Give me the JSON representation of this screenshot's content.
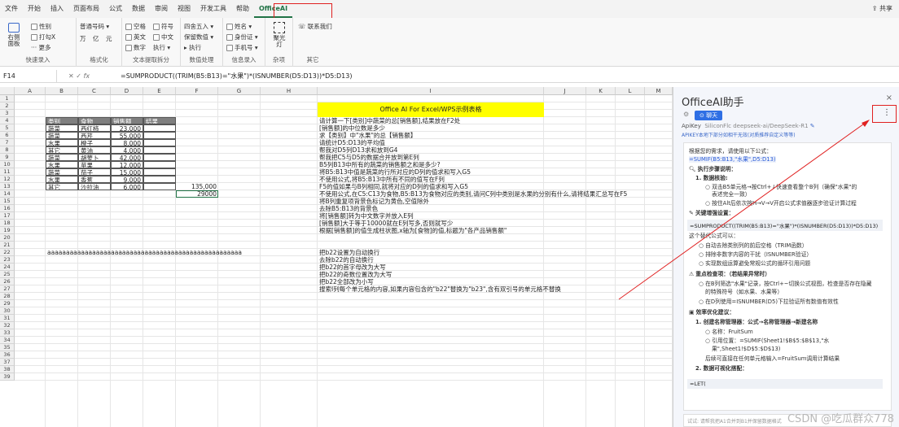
{
  "ribbon": {
    "tabs": [
      "文件",
      "开始",
      "插入",
      "页面布局",
      "公式",
      "数据",
      "审阅",
      "视图",
      "开发工具",
      "帮助",
      "OfficeAI"
    ],
    "active_tab": "OfficeAI",
    "share_label": "共享",
    "groups": [
      {
        "label": "快速录入",
        "items": [
          "右侧面板",
          "性别",
          "打勾X",
          "更多"
        ]
      },
      {
        "label": "格式化",
        "items": [
          "普通号码",
          "万",
          "亿",
          "元"
        ]
      },
      {
        "label": "文本提取拆分",
        "items": [
          "空格",
          "符号",
          "英文",
          "中文",
          "数字",
          "执行"
        ]
      },
      {
        "label": "数值处理",
        "items": [
          "四舍五入",
          "保留数值",
          "执行"
        ]
      },
      {
        "label": "信息录入",
        "items": [
          "姓名",
          "身份证",
          "手机号"
        ]
      },
      {
        "label": "杂项",
        "items": [
          "聚光灯"
        ]
      },
      {
        "label": "其它",
        "items": [
          "联系我们"
        ]
      }
    ]
  },
  "formula_bar": {
    "cell_ref": "F14",
    "fx": "fx",
    "formula": "=SUMPRODUCT((TRIM(B5:B13)=\"水果\")*(ISNUMBER(D5:D13))*D5:D13)"
  },
  "sheet": {
    "columns": [
      "A",
      "B",
      "C",
      "D",
      "E",
      "F",
      "G",
      "H",
      "I",
      "J",
      "K",
      "L",
      "M"
    ],
    "rows": [
      "1",
      "2",
      "3",
      "4",
      "5",
      "6",
      "7",
      "8",
      "9",
      "10",
      "11",
      "12",
      "13",
      "14",
      "15",
      "16",
      "17",
      "18",
      "19",
      "20",
      "21",
      "22",
      "23",
      "24",
      "25",
      "26",
      "27",
      "28",
      "29",
      "30",
      "31",
      "32",
      "33",
      "34",
      "35",
      "36",
      "37",
      "38",
      "39"
    ],
    "banner": "Office AI For Excel/WPS示例表格",
    "table_headers": [
      "类别",
      "食物",
      "销售额",
      "结果"
    ],
    "table_rows": [
      [
        "蔬菜",
        "西红柿",
        "23,000"
      ],
      [
        "蔬菜",
        "西芹",
        "55,000"
      ],
      [
        "水果",
        "橙子",
        "8,000"
      ],
      [
        "其它",
        "黄油",
        "4,000"
      ],
      [
        "蔬菜",
        "胡萝卜",
        "42,000"
      ],
      [
        "水果",
        "苹果",
        "12,000"
      ],
      [
        "蔬菜",
        "茄子",
        "15,000"
      ],
      [
        "水果",
        "香蕉",
        "9,000"
      ],
      [
        "其它",
        "沙拉油",
        "6,000"
      ]
    ],
    "f13_value": "135,000",
    "f14_value": "29000",
    "b22_text": "aaaaaaaaaaaaaaaaaaaaaaaaaaaaaaaaaaaaaaaaaaaaaaaaaaaa",
    "instructions_top": [
      "请计算一下[类别]中蔬菜的总[销售额],结果放在F2处",
      "[销售额]的中位数是多少",
      "求【类别】中\"水果\"的总【销售额】",
      "请统计D5:D13的平均值",
      "帮我对D5列D13求和放到G4",
      "帮我把C5与D5的数据合并放到第E列",
      "B5列B13中所有的蔬菜的销售额之和是多少?",
      "将B5:B13中值是蔬菜的行所对应的D列的值求和写入G5",
      "不使用公式,将B5:B13中所有不同的值写在F列",
      "F5的值如果与B列相同,就将对应的D列的值求和写入G5",
      "不使用公式,在C5:C13为食物,B5:B13为食物对应的类别,请问C列中类别是水果的分别有什么,请将结果汇总写在F5",
      "将B列重复项背景色标记为黄色,空值除外",
      "去除B5:B13的背景色",
      "将[销售额]转为中文数字并放入E列",
      "[销售额]大于等于10000就在E列写多,否则就写少",
      "根据[销售额]的值生成柱状图,x轴为[食物]的值,标题为\"各产品销售额\""
    ],
    "instructions_bottom": [
      "把b22设置为自动换行",
      "去除b22的自动换行",
      "把b22的首字母改为大写",
      "把b22的奇数位置改为大写",
      "把b22全部改为小写",
      "搜索I列每个单元格的内容,如果内容包含的\"b22\"替换为\"b23\",含有双引号的单元格不替换"
    ]
  },
  "panel": {
    "title": "OfficeAI助手",
    "close": "×",
    "more": "⋮",
    "chat_button": "聊天",
    "apikey_label": "ApiKey",
    "apikey_value": "SiliconFlc deepseek-ai/DeepSeek-R1",
    "apikey_note": "APIKEY本地下部分如相干无效(对质推荐自定义等等)",
    "lines": [
      "根据您的需求，请使用以下公式：",
      "=SUMIF(B5:B13,\"水果\",D5:D13)",
      "执行步骤说明：",
      "1.  数据核验:",
      "双击B5单元格→按Ctrl+↓快速查看整个B列（确保\"水果\"的",
      "表述完全一致）",
      "按住Alt后依次按H→V→V开启公式求值器逐步验证计算过程",
      "关键增强设置：",
      "=SUMPRODUCT((TRIM(B5:B13)=\"水果\")*(ISNUMBER(D5:D13))*D5:D13)",
      "这个替代公式可以：",
      "自动去除类别列的前后空格（TRIM函数）",
      "排除非数字内容的干扰（ISNUMBER验证）",
      "实现数组运算避免常规公式的循环引用问题",
      "重点检查项：（若结果异常时）",
      "在B列筛选\"水果\"记录，按Ctrl+~切换公式视图，检查是否存在隐藏",
      "的特殊符号（如水果、水果等）",
      "在D列使用=ISNUMBER(D5)下拉验证所有数值有效性",
      "效率优化建议：",
      "1.  创建名称管理器：公式→名称管理器→新建名称",
      "名称：FruitSum",
      "引用位置：=SUMIF(Sheet1!$B$5:$B$13,\"水",
      "果\",Sheet1!$D$5:$D$13)",
      "后续可直接在任何单元格输入=FruitSum调用计算结果",
      "2.  数据可视化搭配：",
      "=LET("
    ],
    "input_placeholder": "试试: 请帮我把A1合并到B1并保留数据格式",
    "watermark": "CSDN @吃瓜群众778"
  }
}
